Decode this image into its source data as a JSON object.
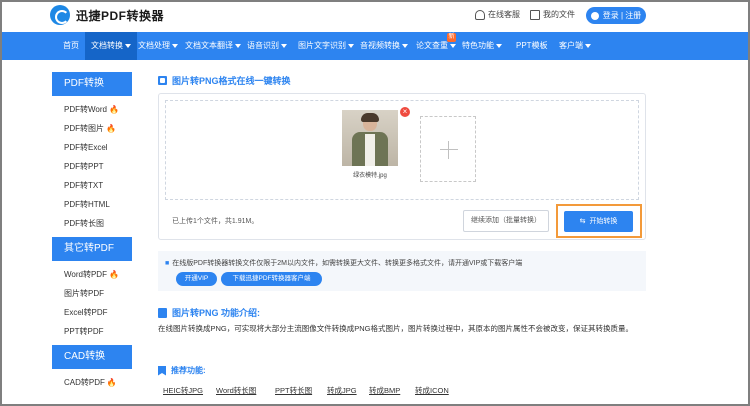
{
  "header": {
    "logo_text": "迅捷PDF转换器",
    "service_label": "在线客服",
    "my_files_label": "我的文件",
    "login_label": "登录 | 注册"
  },
  "nav": {
    "items": [
      {
        "label": "首页",
        "dropdown": false,
        "active": false
      },
      {
        "label": "文档转换",
        "dropdown": true,
        "active": true
      },
      {
        "label": "文档处理",
        "dropdown": true,
        "active": false
      },
      {
        "label": "文档文本翻译",
        "dropdown": true,
        "active": false
      },
      {
        "label": "语音识别",
        "dropdown": true,
        "active": false
      },
      {
        "label": "图片文字识别",
        "dropdown": true,
        "active": false
      },
      {
        "label": "音视频转换",
        "dropdown": true,
        "active": false
      },
      {
        "label": "论文查重",
        "dropdown": true,
        "active": false
      },
      {
        "label": "特色功能",
        "dropdown": true,
        "active": false
      },
      {
        "label": "PPT模板",
        "dropdown": false,
        "active": false
      },
      {
        "label": "客户端",
        "dropdown": true,
        "active": false
      }
    ],
    "new_badge": "新"
  },
  "sidebar": {
    "groups": [
      {
        "title": "PDF转换",
        "items": [
          {
            "label": "PDF转Word",
            "hot": true
          },
          {
            "label": "PDF转图片",
            "hot": true
          },
          {
            "label": "PDF转Excel",
            "hot": false
          },
          {
            "label": "PDF转PPT",
            "hot": false
          },
          {
            "label": "PDF转TXT",
            "hot": false
          },
          {
            "label": "PDF转HTML",
            "hot": false
          },
          {
            "label": "PDF转长图",
            "hot": false
          }
        ]
      },
      {
        "title": "其它转PDF",
        "items": [
          {
            "label": "Word转PDF",
            "hot": true
          },
          {
            "label": "图片转PDF",
            "hot": false
          },
          {
            "label": "Excel转PDF",
            "hot": false
          },
          {
            "label": "PPT转PDF",
            "hot": false
          }
        ]
      },
      {
        "title": "CAD转换",
        "items": [
          {
            "label": "CAD转PDF",
            "hot": true
          }
        ]
      }
    ]
  },
  "main": {
    "title": "图片转PNG格式在线一键转换",
    "file": {
      "name": "绿衣模特.jpg"
    },
    "upload_status": "已上传1个文件，共1.91M。",
    "add_more_label": "继续添加（批量转换）",
    "start_label": "开始转换",
    "notice": "在线版PDF转换器转换文件仅限于2M以内文件，如需转换更大文件、转换更多格式文件，请开通VIP或下载客户端",
    "vip_label": "开通VIP",
    "download_label": "下载迅捷PDF转换器客户端",
    "intro_title": "图片转PNG 功能介绍:",
    "intro_text": "在线图片转换成PNG，可实现将大部分主流图像文件转换成PNG格式图片，图片转换过程中，其原本的图片属性不会被改变，保证其转换质量。",
    "rec_title": "推荐功能:",
    "rec_links": [
      "HEIC转JPG",
      "Word转长图",
      "PPT转长图",
      "转成JPG",
      "转成BMP",
      "转成ICON"
    ]
  },
  "colors": {
    "primary": "#2d84f0",
    "hot": "#ff5a1f",
    "highlight": "#f39a3a",
    "close": "#ef4b3f"
  }
}
